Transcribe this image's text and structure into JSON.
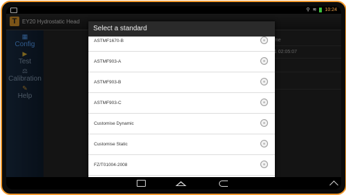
{
  "app": {
    "title": "EY20 Hydrostatic Head",
    "icon": "app-logo-icon"
  },
  "statusbar": {
    "time": "10:24",
    "icons": [
      "signal-icon",
      "wifi-icon",
      "battery-icon"
    ]
  },
  "sidebar": {
    "items": [
      {
        "label": "Config",
        "icon": "settings-icon",
        "active": true
      },
      {
        "label": "Test",
        "icon": "play-icon",
        "active": false
      },
      {
        "label": "Calibration",
        "icon": "calibration-icon",
        "active": false
      },
      {
        "label": "Help",
        "icon": "help-book-icon",
        "active": false
      }
    ]
  },
  "background": {
    "name_label": "ame",
    "date_value": "21 02:05:07"
  },
  "dialog": {
    "title": "Select a standard",
    "options": [
      "ASTMF1670-B",
      "ASTMF903-A",
      "ASTMF903-B",
      "ASTMF903-C",
      "Customise Dynamic",
      "Customise Static",
      "FZ/T01004-2008"
    ]
  },
  "colors": {
    "frame": "#f29a2e",
    "accent": "#58a6ff",
    "dialog_title_bg": "#2a2a2a"
  }
}
